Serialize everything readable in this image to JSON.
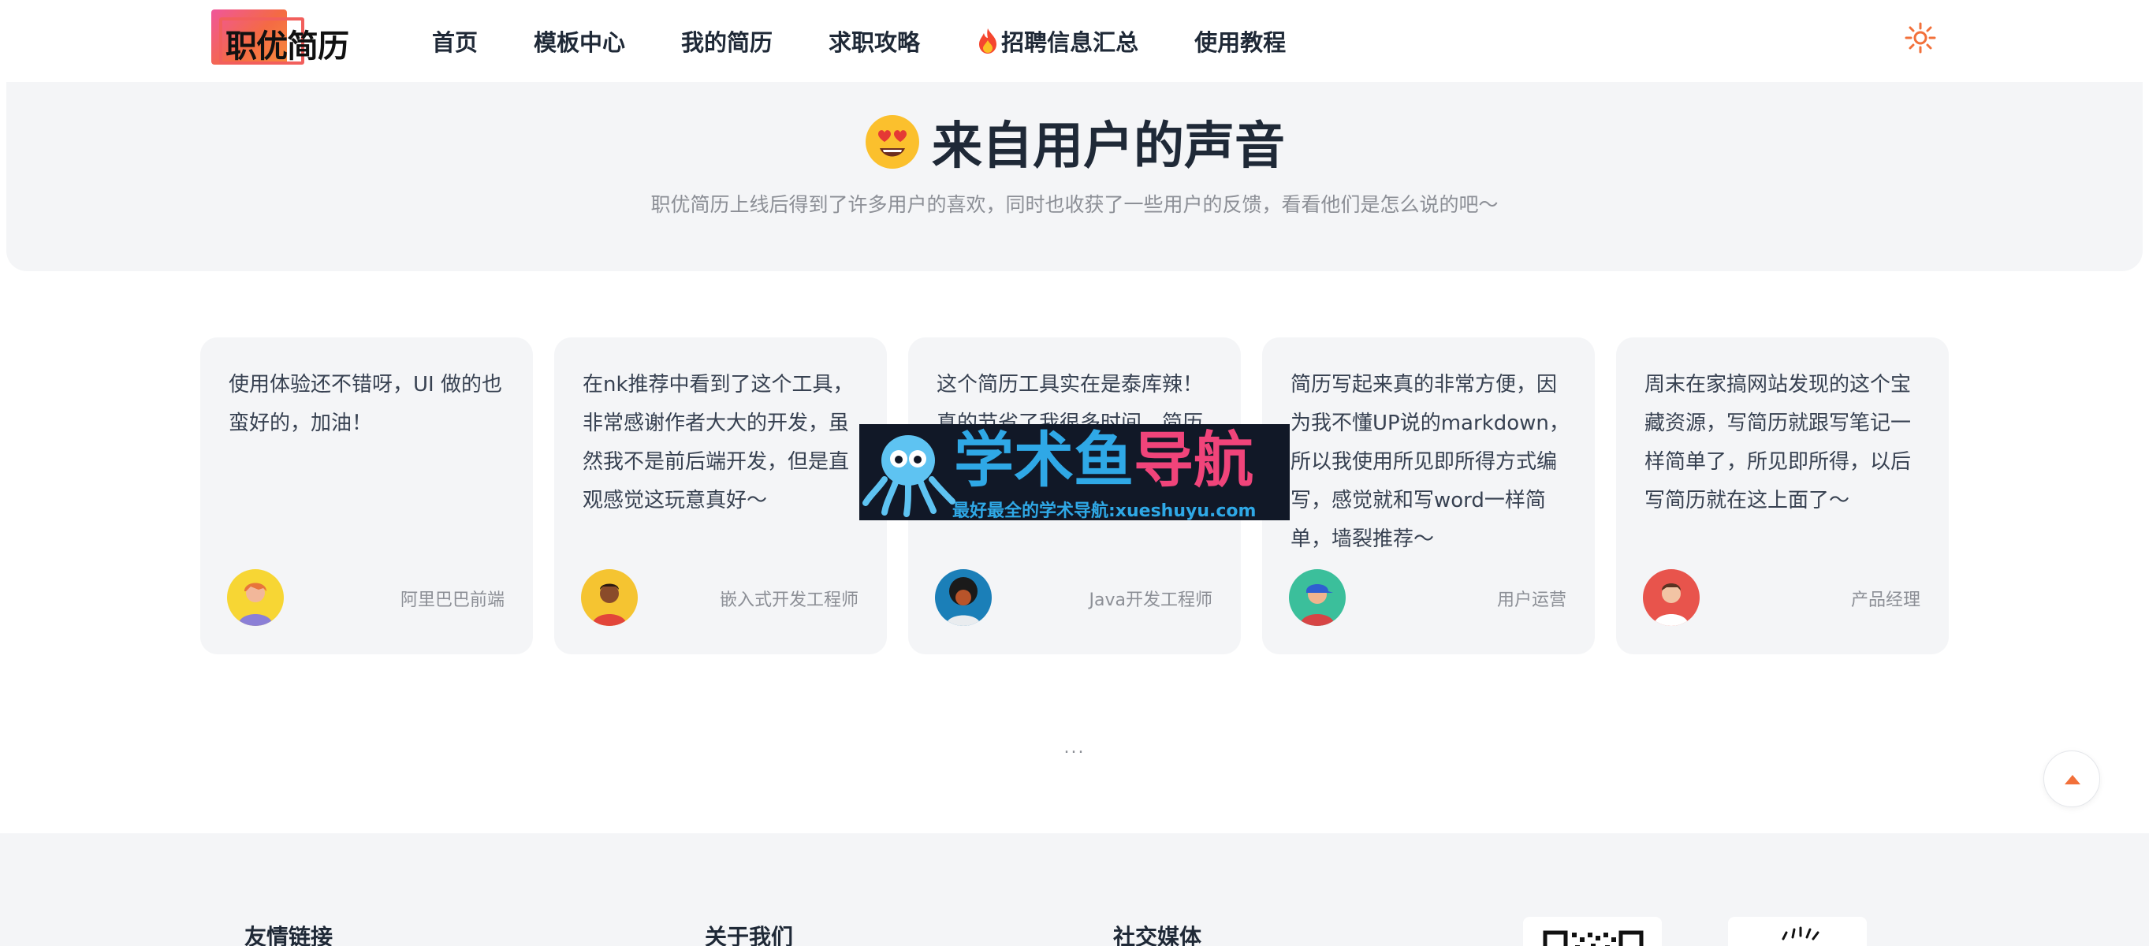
{
  "header": {
    "logo_text": "职优简历",
    "nav": [
      {
        "label": "首页"
      },
      {
        "label": "模板中心"
      },
      {
        "label": "我的简历"
      },
      {
        "label": "求职攻略"
      },
      {
        "label": "招聘信息汇总",
        "icon": "fire-icon"
      },
      {
        "label": "使用教程"
      }
    ],
    "theme_icon": "sun-icon"
  },
  "voice": {
    "title": "来自用户的声音",
    "title_icon": "heart-eyes-emoji-icon",
    "subtitle": "职优简历上线后得到了许多用户的喜欢，同时也收获了一些用户的反馈，看看他们是怎么说的吧～"
  },
  "testimonials": [
    {
      "text": "使用体验还不错呀，UI 做的也蛮好的，加油！",
      "role": "阿里巴巴前端",
      "avatar_bg": "#f7d634"
    },
    {
      "text": "在nk推荐中看到了这个工具，非常感谢作者大大的开发，虽然我不是前后端开发，但是直观感觉这玩意真好～",
      "role": "嵌入式开发工程师",
      "avatar_bg": "#f5c431"
    },
    {
      "text": "这个简历工具实在是泰库辣！真的节省了我很多时间，简历模板",
      "role": "Java开发工程师",
      "avatar_bg": "#1b7fb8"
    },
    {
      "text": "简历写起来真的非常方便，因为我不懂UP说的markdown，所以我使用所见即所得方式编写，感觉就和写word一样简单，墙裂推荐～",
      "role": "用户运营",
      "avatar_bg": "#3bbf9b"
    },
    {
      "text": "周末在家搞网站发现的这个宝藏资源，写简历就跟写笔记一样简单了，所见即所得，以后写简历就在这上面了～",
      "role": "产品经理",
      "avatar_bg": "#e8544c"
    }
  ],
  "watermark": {
    "main_a": "学术",
    "main_b": "鱼",
    "main_c": "导航",
    "sub": "最好最全的学术导航:xueshuyu.com"
  },
  "more": "...",
  "back_to_top_icon": "arrow-up-icon",
  "footer": {
    "col1": "友情链接",
    "col2": "关于我们",
    "col3": "社交媒体"
  },
  "colors": {
    "accent": "#f2703a",
    "card_bg": "#f4f5f7",
    "muted_text": "#8c8f96"
  }
}
